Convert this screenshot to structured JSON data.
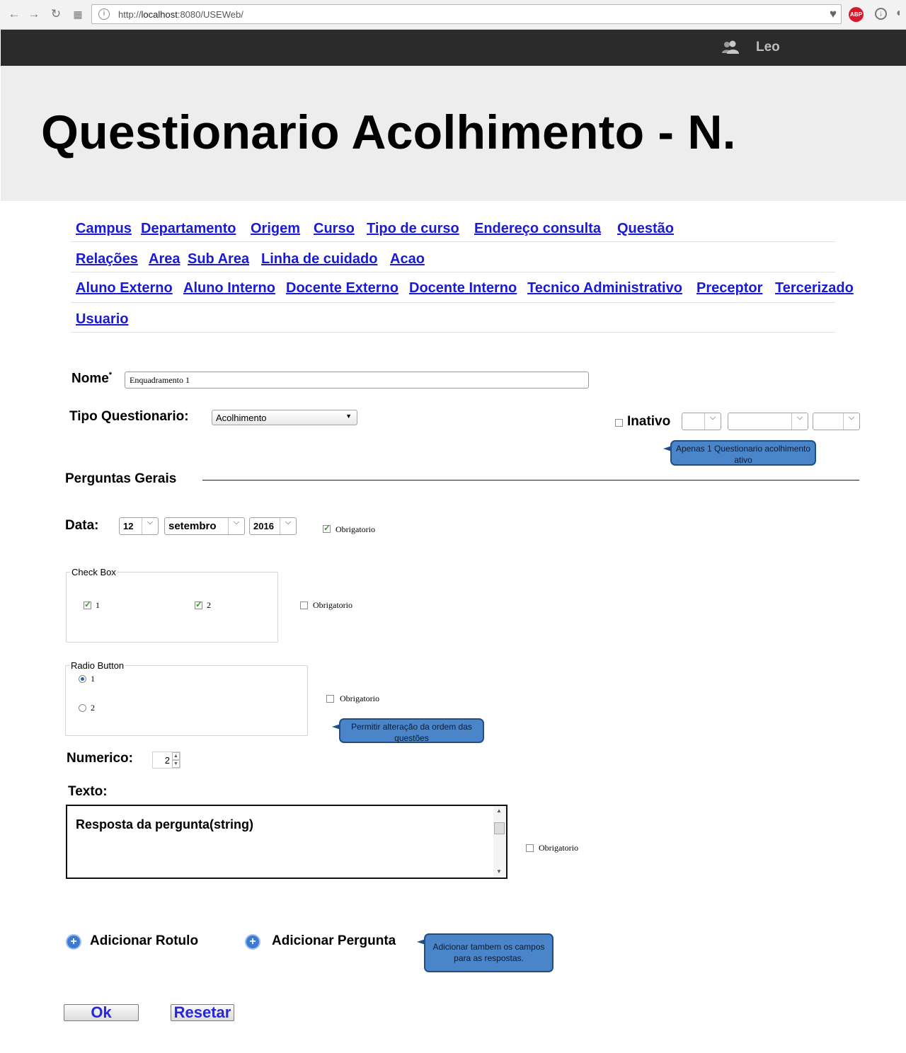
{
  "browser": {
    "url_prefix": "http://",
    "url_host": "localhost",
    "url_rest": ":8080/USEWeb/",
    "abp_label": "ABP"
  },
  "topbar": {
    "username": "Leo"
  },
  "header": {
    "title": "Questionario Acolhimento - N."
  },
  "nav": {
    "row1": [
      "Campus",
      "Departamento",
      "Origem",
      "Curso",
      "Tipo de curso",
      "Endereço consulta",
      "Questão"
    ],
    "row2": [
      "Relações",
      "Area",
      "Sub Area",
      "Linha de cuidado",
      "Acao"
    ],
    "row3": [
      "Aluno Externo",
      "Aluno Interno",
      "Docente Externo",
      "Docente Interno",
      "Tecnico Administrativo",
      "Preceptor",
      "Tercerizado"
    ],
    "row4": [
      "Usuario"
    ]
  },
  "form": {
    "nome_label": "Nome",
    "nome_required_mark": "*",
    "nome_value": "Enquadramento 1",
    "tipo_label": "Tipo Questionario:",
    "tipo_value": "Acolhimento",
    "inativo_label": "Inativo",
    "inativo_tooltip": "Apenas 1 Questionario acolhimento ativo",
    "perguntas_gerais": "Perguntas Gerais",
    "data_label": "Data:",
    "data_day": "12",
    "data_month": "setembro",
    "data_year": "2016",
    "obrigatorio": "Obrigatorio",
    "checkbox_legend": "Check Box",
    "checkbox_opt1": "1",
    "checkbox_opt2": "2",
    "radio_legend": "Radio Button",
    "radio_opt1": "1",
    "radio_opt2": "2",
    "order_tooltip": "Permitir alteração da ordem das questões",
    "numerico_label": "Numerico:",
    "numerico_value": "2",
    "texto_label": "Texto:",
    "texto_value": "Resposta da pergunta(string)",
    "add_rotulo": "Adicionar Rotulo",
    "add_pergunta": "Adicionar Pergunta",
    "add_tooltip": "Adicionar tambem os campos para as respostas.",
    "ok_button": "Ok",
    "reset_button": "Resetar"
  }
}
